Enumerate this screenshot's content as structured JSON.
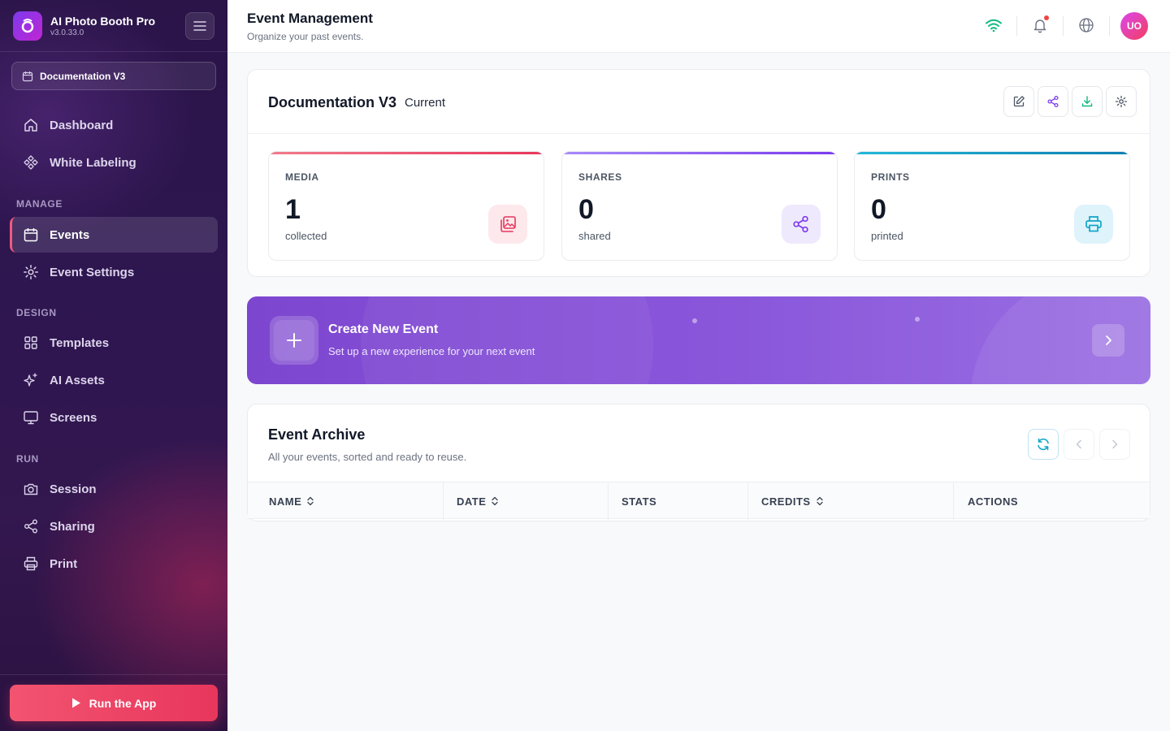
{
  "app": {
    "name": "AI Photo Booth Pro",
    "version": "v3.0.33.0"
  },
  "sidebar": {
    "current_event": "Documentation V3",
    "items_top": [
      {
        "label": "Dashboard"
      },
      {
        "label": "White Labeling"
      }
    ],
    "sections": [
      {
        "title": "MANAGE",
        "items": [
          {
            "label": "Events",
            "active": true
          },
          {
            "label": "Event Settings"
          }
        ]
      },
      {
        "title": "DESIGN",
        "items": [
          {
            "label": "Templates"
          },
          {
            "label": "AI Assets"
          },
          {
            "label": "Screens"
          }
        ]
      },
      {
        "title": "RUN",
        "items": [
          {
            "label": "Session"
          },
          {
            "label": "Sharing"
          },
          {
            "label": "Print"
          }
        ]
      }
    ],
    "run_button": "Run the App"
  },
  "header": {
    "title": "Event Management",
    "subtitle": "Organize your past events.",
    "avatar_initials": "UO",
    "icons": [
      "wifi-icon",
      "bell-icon",
      "globe-icon"
    ]
  },
  "event_card": {
    "title": "Documentation V3",
    "tag": "Current",
    "actions": [
      "edit-icon",
      "share-icon",
      "download-icon",
      "settings-icon"
    ],
    "stats": [
      {
        "label": "MEDIA",
        "value": "1",
        "unit": "collected",
        "color": "#f0546f",
        "icon": "images-icon"
      },
      {
        "label": "SHARES",
        "value": "0",
        "unit": "shared",
        "color": "#8b5cf6",
        "icon": "share-icon"
      },
      {
        "label": "PRINTS",
        "value": "0",
        "unit": "printed",
        "color": "#0ea5c9",
        "icon": "printer-icon"
      }
    ]
  },
  "create_event": {
    "title": "Create New Event",
    "subtitle": "Set up a new experience for your next event"
  },
  "archive": {
    "title": "Event Archive",
    "subtitle": "All your events, sorted and ready to reuse.",
    "columns": [
      {
        "label": "NAME",
        "sortable": true
      },
      {
        "label": "DATE",
        "sortable": true
      },
      {
        "label": "STATS",
        "sortable": false
      },
      {
        "label": "CREDITS",
        "sortable": true
      },
      {
        "label": "ACTIONS",
        "sortable": false
      }
    ]
  },
  "colors": {
    "accent": "#e8365c",
    "brand_purple": "#7d46cf",
    "sidebar_bg": "#2e1650",
    "teal": "#0ea5c9",
    "green": "#10b981"
  }
}
